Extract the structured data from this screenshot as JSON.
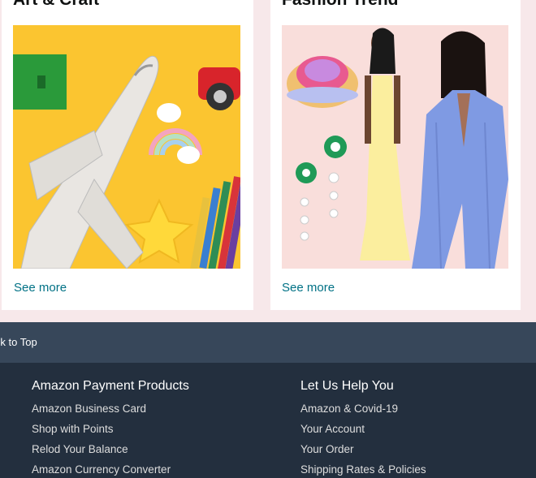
{
  "cards": [
    {
      "title": "Art & Craft",
      "image_alt": "Toy airplane with colored pencils on yellow background",
      "see_more": "See more"
    },
    {
      "title": "Fashion Trend",
      "image_alt": "Women in summer fashion with hat and earrings",
      "see_more": "See more"
    }
  ],
  "back_to_top": {
    "label": "Back to Top"
  },
  "footer": {
    "columns": [
      {
        "heading": "Amazon Payment Products",
        "links": [
          "Amazon Business Card",
          "Shop with Points",
          "Relod Your Balance",
          "Amazon Currency Converter"
        ]
      },
      {
        "heading": "Let Us Help You",
        "links": [
          "Amazon & Covid-19",
          "Your Account",
          "Your Order",
          "Shipping Rates & Policies"
        ]
      }
    ]
  },
  "colors": {
    "link": "#007185",
    "back_to_top_bg": "#37475a",
    "footer_bg": "#232f3e",
    "page_bg": "#f7e8ea"
  }
}
